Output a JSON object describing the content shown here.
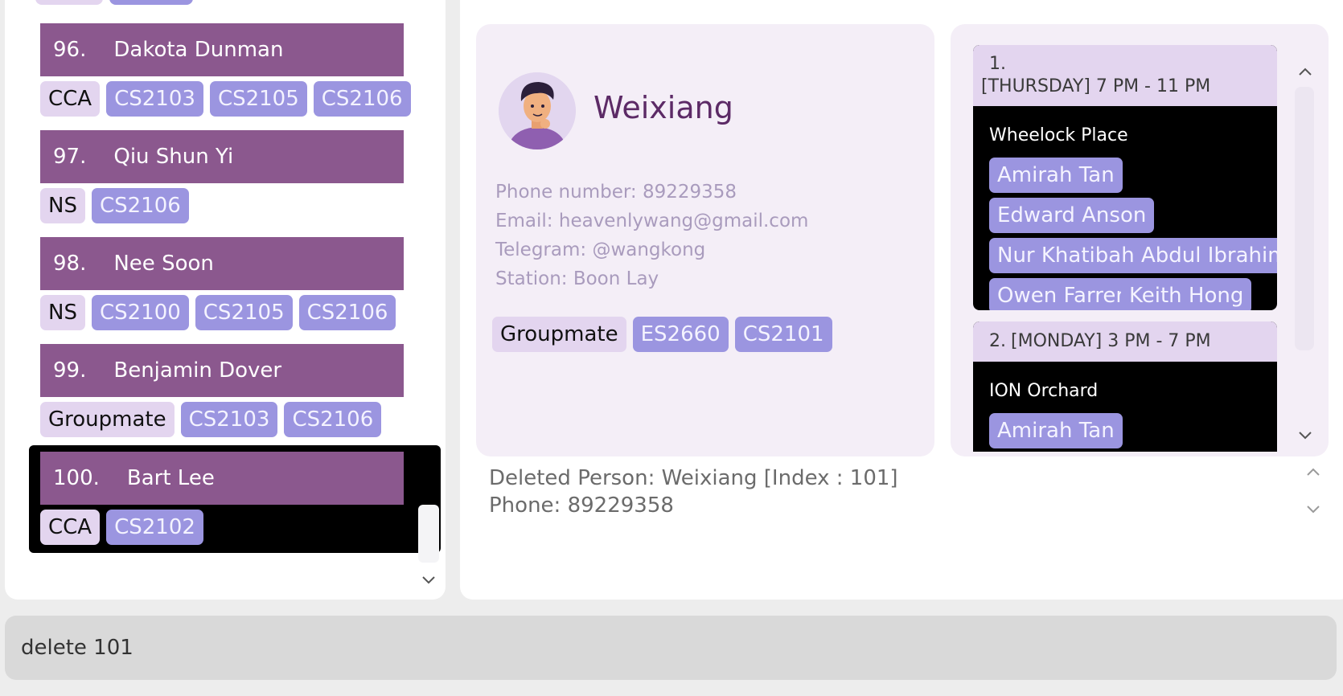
{
  "person_list": {
    "cards": [
      {
        "index": "96.",
        "name": "Dakota Dunman",
        "tags": [
          {
            "label": "CCA",
            "kind": "cat"
          },
          {
            "label": "CS2103",
            "kind": "mod"
          },
          {
            "label": "CS2105",
            "kind": "mod"
          },
          {
            "label": "CS2106",
            "kind": "mod"
          }
        ]
      },
      {
        "index": "97.",
        "name": "Qiu Shun Yi",
        "tags": [
          {
            "label": "NS",
            "kind": "cat"
          },
          {
            "label": "CS2106",
            "kind": "mod"
          }
        ]
      },
      {
        "index": "98.",
        "name": "Nee Soon",
        "tags": [
          {
            "label": "NS",
            "kind": "cat"
          },
          {
            "label": "CS2100",
            "kind": "mod"
          },
          {
            "label": "CS2105",
            "kind": "mod"
          },
          {
            "label": "CS2106",
            "kind": "mod"
          }
        ]
      },
      {
        "index": "99.",
        "name": "Benjamin Dover",
        "tags": [
          {
            "label": "Groupmate",
            "kind": "cat"
          },
          {
            "label": "CS2103",
            "kind": "mod"
          },
          {
            "label": "CS2106",
            "kind": "mod"
          }
        ]
      },
      {
        "index": "100.",
        "name": "Bart Lee",
        "selected": true,
        "tags": [
          {
            "label": "CCA",
            "kind": "cat"
          },
          {
            "label": "CS2102",
            "kind": "mod"
          }
        ]
      }
    ]
  },
  "person_detail": {
    "name": "Weixiang",
    "phone": "Phone number: 89229358",
    "email": "Email: heavenlywang@gmail.com",
    "telegram": "Telegram: @wangkong",
    "station": "Station: Boon Lay",
    "tags": [
      {
        "label": "Groupmate",
        "kind": "cat"
      },
      {
        "label": "ES2660",
        "kind": "mod"
      },
      {
        "label": "CS2101",
        "kind": "mod"
      }
    ]
  },
  "meetings": [
    {
      "number": "1.",
      "time": "[THURSDAY] 7 PM - 11 PM",
      "place": "Wheelock Place",
      "participants": [
        "Amirah Tan",
        "Edward Anson",
        "Nur Khatibah Abdul Ibrahim",
        "Owen Farrer",
        "Keith Hong"
      ]
    },
    {
      "number": "2.",
      "time": "[MONDAY] 3 PM - 7 PM",
      "place": "ION Orchard",
      "participants": [
        "Amirah Tan"
      ]
    }
  ],
  "result": {
    "line1": "Deleted Person: Weixiang [Index : 101]",
    "line2": "Phone: 89229358"
  },
  "command": {
    "value": "delete 101"
  },
  "colors": {
    "header": "#8b588e",
    "category_tag": "#e3d5ef",
    "module_tag": "#9b95e0",
    "accent_name": "#5c2a66",
    "detail_text": "#a99bbd"
  }
}
